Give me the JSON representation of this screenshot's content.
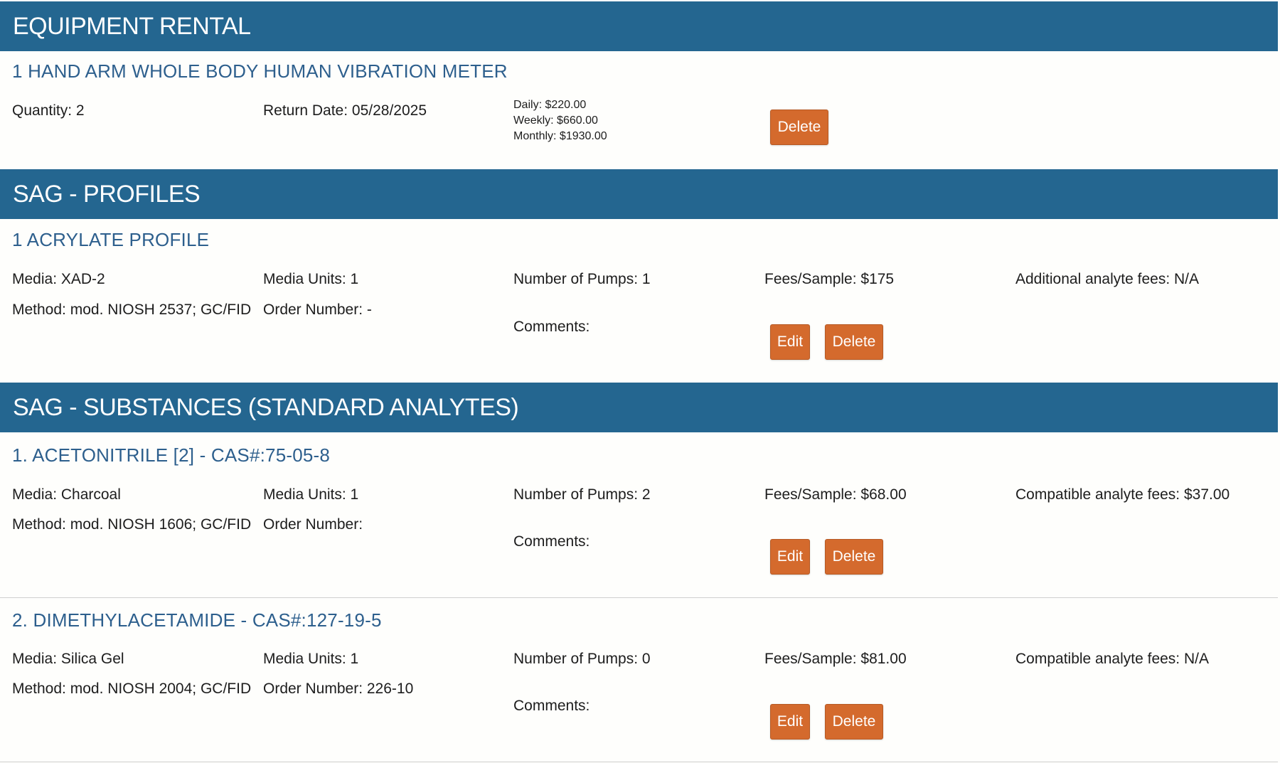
{
  "colors": {
    "header_bg": "#246690",
    "header_text": "#ffffff",
    "item_title": "#2d5f8d",
    "button_bg": "#d46a2d",
    "page_bg": "#fefefc"
  },
  "equipment_rental": {
    "header": "EQUIPMENT RENTAL",
    "item": {
      "title": "1 HAND ARM WHOLE BODY HUMAN VIBRATION METER",
      "quantity": "Quantity: 2",
      "return_date": "Return Date: 05/28/2025",
      "daily": "Daily: $220.00",
      "weekly": "Weekly: $660.00",
      "monthly": "Monthly: $1930.00",
      "delete_label": "Delete"
    }
  },
  "profiles": {
    "header": "SAG - PROFILES",
    "item": {
      "title": "1 ACRYLATE PROFILE",
      "media": "Media: XAD-2",
      "media_units": "Media Units: 1",
      "pumps": "Number of Pumps: 1",
      "fees": "Fees/Sample: $175",
      "additional_fees": "Additional analyte fees: N/A",
      "method": "Method: mod. NIOSH 2537; GC/FID",
      "order_number": "Order Number: -",
      "comments": "Comments:",
      "edit_label": "Edit",
      "delete_label": "Delete"
    }
  },
  "substances": {
    "header": "SAG - SUBSTANCES (STANDARD ANALYTES)",
    "items": [
      {
        "title": "1. ACETONITRILE [2] - CAS#:75-05-8",
        "media": "Media: Charcoal",
        "media_units": "Media Units: 1",
        "pumps": "Number of Pumps: 2",
        "fees": "Fees/Sample: $68.00",
        "compatible_fees": "Compatible analyte fees: $37.00",
        "method": "Method: mod. NIOSH 1606; GC/FID",
        "order_number": "Order Number:",
        "comments": "Comments:",
        "edit_label": "Edit",
        "delete_label": "Delete"
      },
      {
        "title": "2. DIMETHYLACETAMIDE - CAS#:127-19-5",
        "media": "Media: Silica Gel",
        "media_units": "Media Units: 1",
        "pumps": "Number of Pumps: 0",
        "fees": "Fees/Sample: $81.00",
        "compatible_fees": "Compatible analyte fees: N/A",
        "method": "Method: mod. NIOSH 2004; GC/FID",
        "order_number": "Order Number: 226-10",
        "comments": "Comments:",
        "edit_label": "Edit",
        "delete_label": "Delete"
      }
    ]
  }
}
